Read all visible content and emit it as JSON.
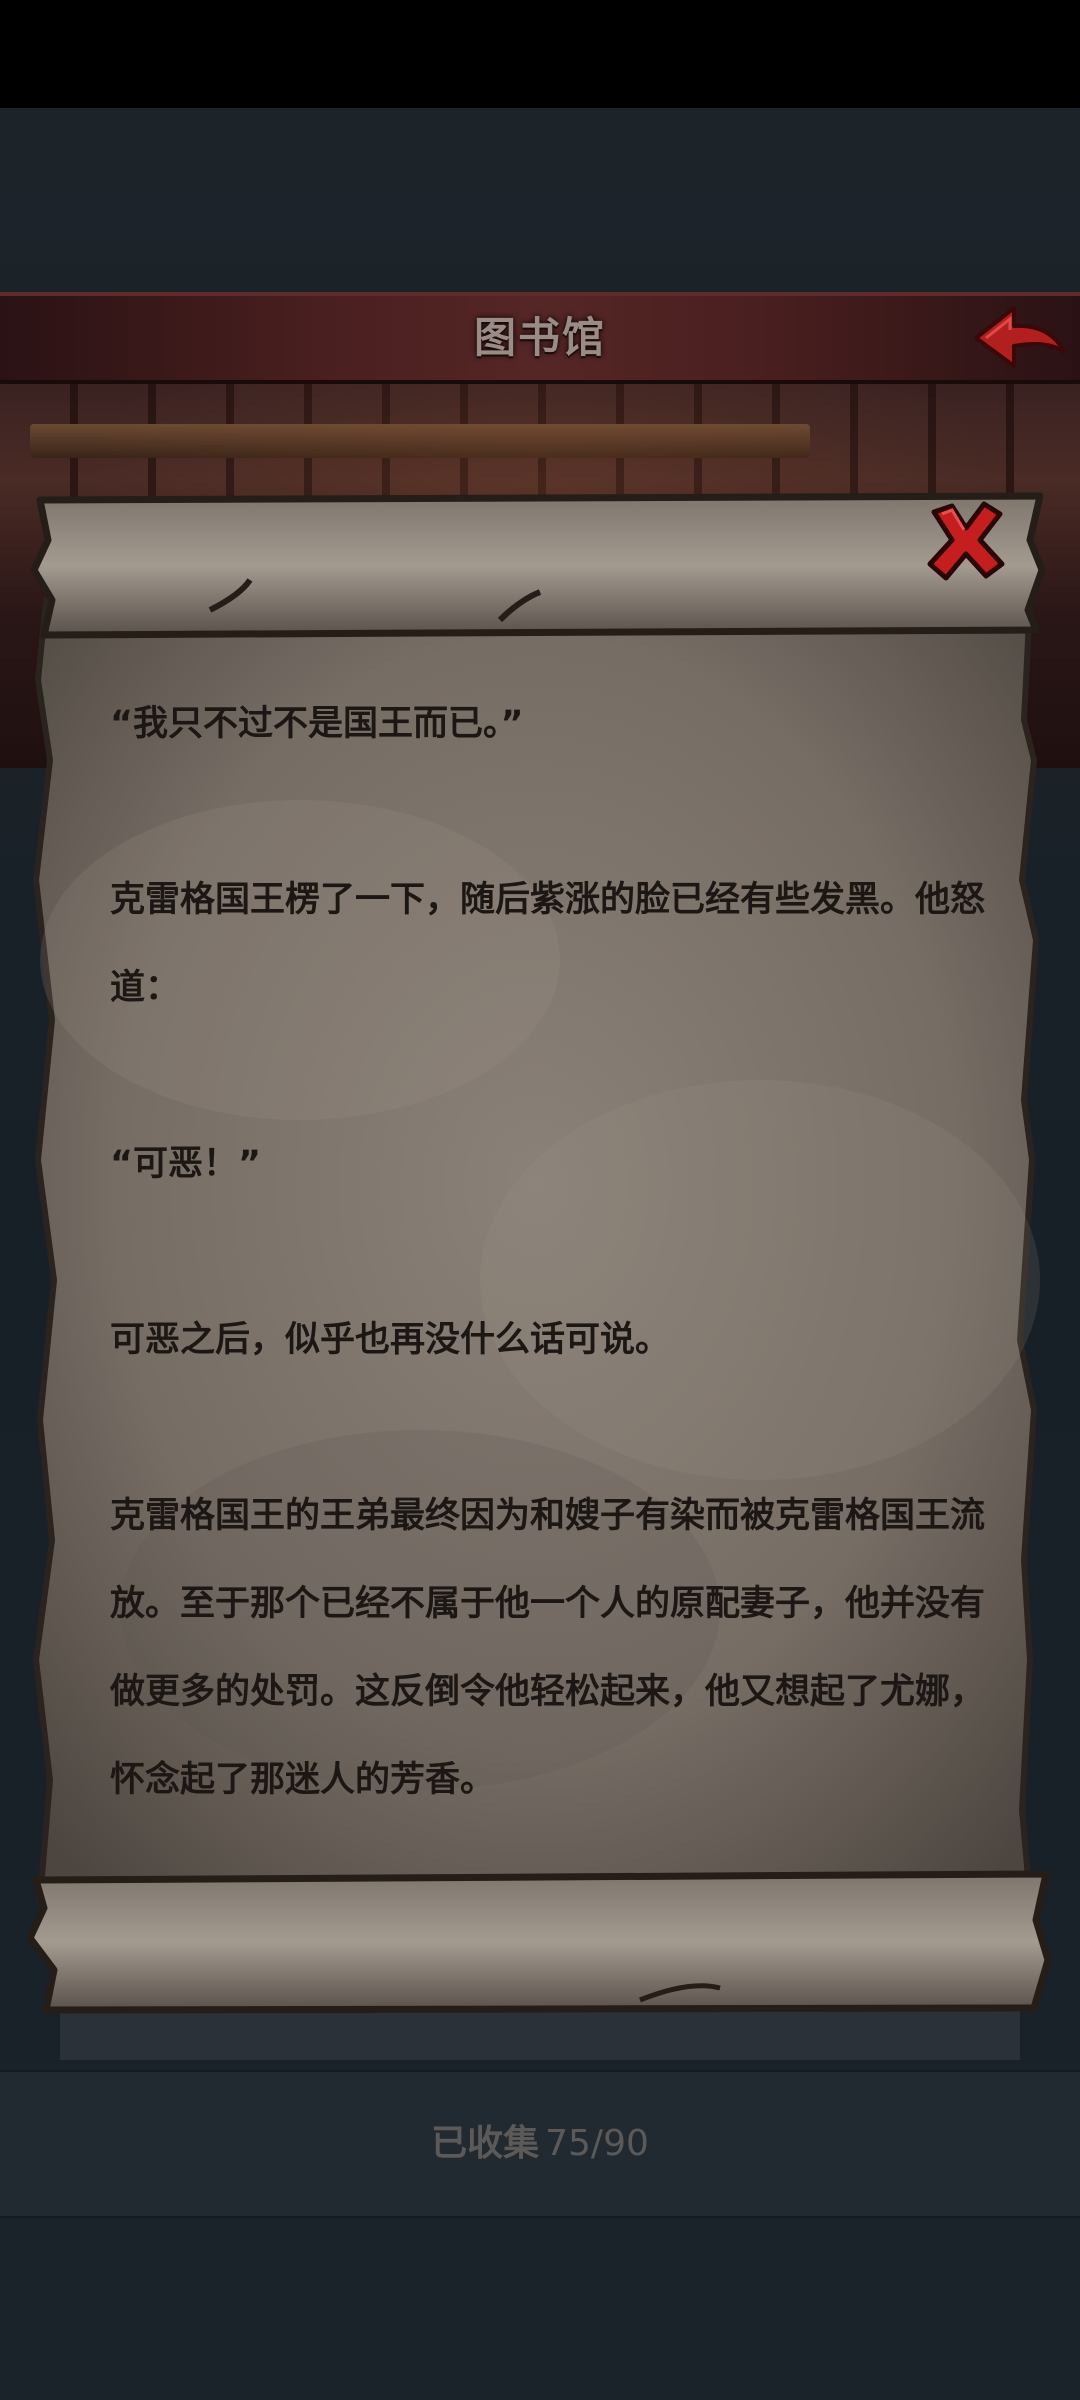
{
  "header": {
    "title": "图书馆"
  },
  "scroll": {
    "paragraphs": [
      "“我只不过不是国王而已。”",
      "克雷格国王楞了一下，随后紫涨的脸已经有些发黑。他怒道：",
      "“可恶！”",
      "可恶之后，似乎也再没什么话可说。",
      "克雷格国王的王弟最终因为和嫂子有染而被克雷格国王流放。至于那个已经不属于他一个人的原配妻子，他并没有做更多的处罚。这反倒令他轻松起来，他又想起了尤娜，怀念起了那迷人的芳香。"
    ]
  },
  "footer": {
    "collected_label": "已收集",
    "collected_count": "75/90"
  },
  "icons": {
    "close": "close-x-icon",
    "back": "back-arrow-icon"
  },
  "colors": {
    "header_red": "#4a1f1f",
    "parchment": "#7a7068",
    "close_red": "#c41e1e"
  }
}
